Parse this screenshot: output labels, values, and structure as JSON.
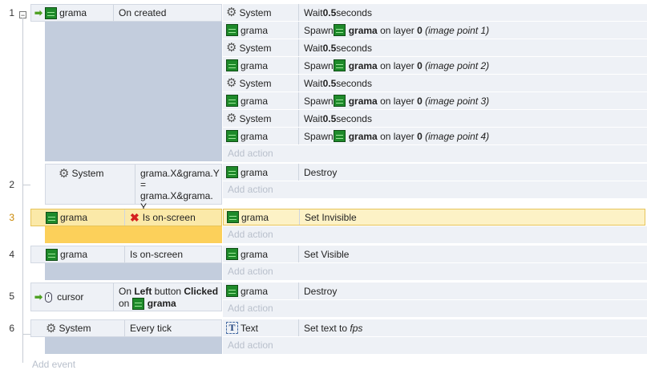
{
  "events": [
    {
      "number": "1",
      "collapse_glyph": "−",
      "object": "grama",
      "condition": "On created",
      "actions": [
        {
          "object": "System",
          "prefix": "Wait ",
          "value": "0.5",
          "suffix": " seconds"
        },
        {
          "object": "grama",
          "verb": "Spawn ",
          "target": "grama",
          "mid": " on layer ",
          "layer": "0",
          "point": "(image point 1)"
        },
        {
          "object": "System",
          "prefix": "Wait ",
          "value": "0.5",
          "suffix": " seconds"
        },
        {
          "object": "grama",
          "verb": "Spawn ",
          "target": "grama",
          "mid": " on layer ",
          "layer": "0",
          "point": "(image point 2)"
        },
        {
          "object": "System",
          "prefix": "Wait ",
          "value": "0.5",
          "suffix": " seconds"
        },
        {
          "object": "grama",
          "verb": "Spawn ",
          "target": "grama",
          "mid": " on layer ",
          "layer": "0",
          "point": "(image point 3)"
        },
        {
          "object": "System",
          "prefix": "Wait ",
          "value": "0.5",
          "suffix": " seconds"
        },
        {
          "object": "grama",
          "verb": "Spawn ",
          "target": "grama",
          "mid": " on layer ",
          "layer": "0",
          "point": "(image point 4)"
        }
      ]
    },
    {
      "number": "2",
      "object": "System",
      "condition_lines": [
        "grama.X&grama.Y",
        "= grama.X&grama.",
        "Y"
      ],
      "actions": [
        {
          "object": "grama",
          "text": "Destroy"
        }
      ]
    },
    {
      "number": "3",
      "object": "grama",
      "condition": "Is on-screen",
      "actions": [
        {
          "object": "grama",
          "text": "Set Invisible"
        }
      ]
    },
    {
      "number": "4",
      "object": "grama",
      "condition": "Is on-screen",
      "actions": [
        {
          "object": "grama",
          "text": "Set Visible"
        }
      ]
    },
    {
      "number": "5",
      "object": "cursor",
      "cond_pre": "On ",
      "cond_b1": "Left",
      "cond_mid": " button ",
      "cond_b2": "Clicked",
      "cond_on": "on ",
      "cond_target": "grama",
      "actions": [
        {
          "object": "grama",
          "text": "Destroy"
        }
      ]
    },
    {
      "number": "6",
      "object": "System",
      "condition": "Every tick",
      "actions": [
        {
          "object": "Text",
          "prefix": "Set text to ",
          "value": "fps"
        }
      ]
    }
  ],
  "add_action_label": "Add action",
  "add_event_label": "Add event",
  "icons": {
    "grama": "grama-sprite-icon",
    "system": "gear-icon",
    "text": "text-object-icon",
    "cursor": "mouse-icon",
    "trigger": "green-arrow-icon",
    "invert": "red-x-icon"
  },
  "colors": {
    "selected_row": "#fdf2c6",
    "selected_cond": "#fcd05a",
    "condition_bg": "#eef1f6",
    "filler": "#c3cddd"
  }
}
